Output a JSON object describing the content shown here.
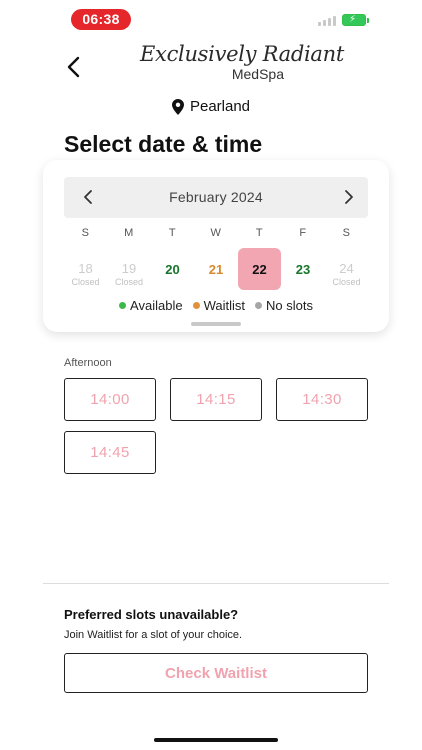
{
  "status_bar": {
    "time": "06:38",
    "accent": "#e5262a",
    "battery_color": "#34c759"
  },
  "header": {
    "back_icon": "chevron-left-icon",
    "logo_script": "Exclusively Radiant",
    "logo_sub": "MedSpa",
    "location_icon": "map-pin-icon",
    "location": "Pearland"
  },
  "page_title": "Select date & time",
  "calendar": {
    "month": "February 2024",
    "prev_icon": "chevron-left-icon",
    "next_icon": "chevron-right-icon",
    "weekdays": [
      "S",
      "M",
      "T",
      "W",
      "T",
      "F",
      "S"
    ],
    "days": [
      {
        "num": "18",
        "sub": "Closed",
        "status": "closed"
      },
      {
        "num": "19",
        "sub": "Closed",
        "status": "closed"
      },
      {
        "num": "20",
        "sub": "",
        "status": "available"
      },
      {
        "num": "21",
        "sub": "",
        "status": "waitlist"
      },
      {
        "num": "22",
        "sub": "",
        "status": "selected"
      },
      {
        "num": "23",
        "sub": "",
        "status": "available"
      },
      {
        "num": "24",
        "sub": "Closed",
        "status": "closed"
      }
    ],
    "legend": [
      {
        "label": "Available",
        "color": "#3cb94a"
      },
      {
        "label": "Waitlist",
        "color": "#e0913a"
      },
      {
        "label": "No slots",
        "color": "#a6a6a6"
      }
    ],
    "selected_color": "#f1a6b2"
  },
  "afternoon": {
    "label": "Afternoon",
    "slots": [
      "14:00",
      "14:15",
      "14:30",
      "14:45"
    ]
  },
  "preferred": {
    "title": "Preferred slots unavailable?",
    "subtitle": "Join Waitlist for a slot of your choice.",
    "button": "Check Waitlist"
  },
  "accent_pink": "#f0a3ae"
}
